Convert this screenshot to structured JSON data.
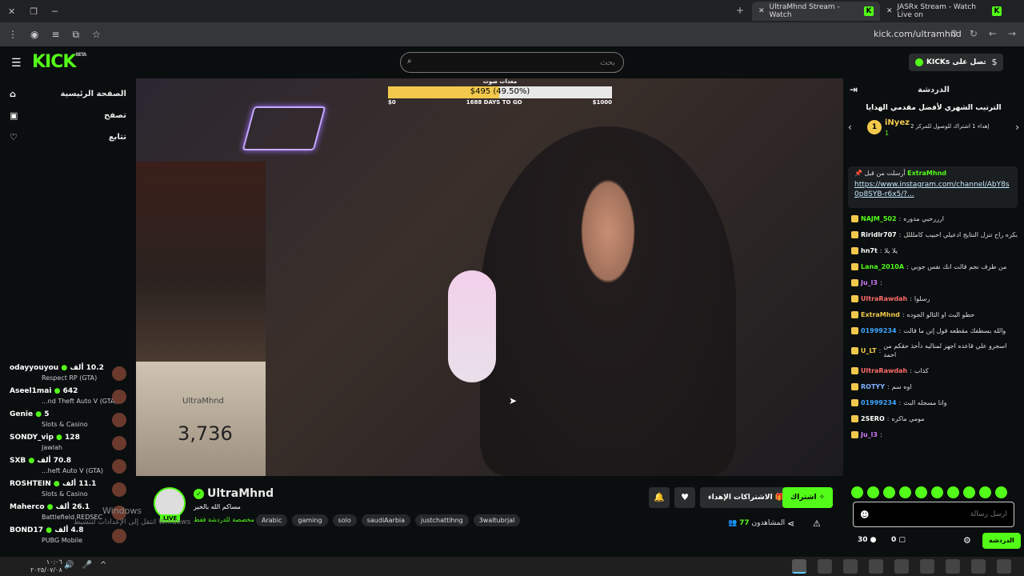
{
  "browser": {
    "tabs": [
      {
        "title": "UltraMhnd Stream - Watch",
        "active": true
      },
      {
        "title": "JASRx Stream - Watch Live on",
        "active": false
      }
    ],
    "url": "kick.com/ultramhnd"
  },
  "header": {
    "logo": "KICK",
    "logo_badge": "BETA",
    "search_placeholder": "بحث",
    "get_kicks": "احصل على KICKs",
    "accent": "#53fc18"
  },
  "sidebar": {
    "nav": [
      {
        "label": "الصفحة الرئيسية",
        "icon": "home-icon"
      },
      {
        "label": "تصفح",
        "icon": "browse-icon"
      },
      {
        "label": "تتابع",
        "icon": "heart-icon"
      }
    ],
    "recommended": [
      {
        "name": "odayyouyou",
        "game": "Respect RP (GTA)",
        "viewers": "10.2 ألف"
      },
      {
        "name": "Aseel1mai",
        "game": "...nd Theft Auto V (GTA)",
        "viewers": "642"
      },
      {
        "name": "Genie",
        "game": "Slots & Casino",
        "viewers": "5"
      },
      {
        "name": "SONDY_vip",
        "game": "Jawlah",
        "viewers": "128"
      },
      {
        "name": "SXB",
        "game": "...heft Auto V (GTA)",
        "viewers": "70.8 ألف"
      },
      {
        "name": "ROSHTEIN",
        "game": "Slots & Casino",
        "viewers": "11.1 ألف"
      },
      {
        "name": "Maherco",
        "game": "Battlefield REDSEC",
        "viewers": "26.1 ألف"
      },
      {
        "name": "BOND17",
        "game": "PUBG Mobile",
        "viewers": "4.8 ألف"
      }
    ]
  },
  "stream": {
    "goal": {
      "label": "معدات صوت",
      "amount_text": "$495 (49.50%)",
      "progress": 0.495,
      "min": "$0",
      "max": "$1000",
      "days_left": "1688 DAYS TO GO"
    },
    "overlay_name": "UltraMhnd",
    "overlay_count": "3,736",
    "streamer": "UltraMhnd",
    "title": "مساكم الله بالخير",
    "category": "مخصصة للدردشة فقط",
    "tags": [
      "Arabic",
      "gaming",
      "solo",
      "saudiAarbia",
      "justchattihng",
      "3waltubrjal"
    ],
    "live_label": "LIVE",
    "subscribe": "اشتراك",
    "gift_subs": "الاشتراكات الإهداء",
    "viewers_label": "المشاهدون",
    "viewers": "77"
  },
  "windows_watermark": {
    "line1": "Windows",
    "line2": "انتقل إلى الإعدادات لتنشيط Windows"
  },
  "chat": {
    "title": "الدردشة",
    "leaderboard_title": "الترتيب الشهري لأفضل مقدمي الهدايا",
    "leader": {
      "rank": "1",
      "name": "iNyez",
      "count": "1",
      "desc": "إهداء 1 اشتراك للوصول للمركز 2"
    },
    "pinned_by": "أرسلت من قبل",
    "pinned_user": "ExtraMhnd",
    "pinned_link": "https://www.instagram.com/channel/AbY8s0p8SYB-r6x5/?...",
    "messages": [
      {
        "user": "NAJM_502",
        "color": "#53fc18",
        "text": "ارررحبي مدوره"
      },
      {
        "user": "Riridlr707",
        "color": "#ffffff",
        "text": "بكره راح تنزل النتايج ادعيلي احبيب كاملللل"
      },
      {
        "user": "hn7t",
        "color": "#ffffff",
        "text": "يلا يلا"
      },
      {
        "user": "Lana_2010A",
        "color": "#53fc18",
        "text": "من طرف نجم قالت انك نفس جوبي"
      },
      {
        "user": "Ju_l3",
        "color": "#d17bff",
        "text": ""
      },
      {
        "user": "UltraRawdah",
        "color": "#ff6b6b",
        "text": "رسلوا"
      },
      {
        "user": "ExtraMhnd",
        "color": "#f2c94c",
        "text": "حطو البث او الثالو الجوده"
      },
      {
        "user": "01999234",
        "color": "#3fa7ff",
        "text": "والله بسطفك مقطعه قول إنن ما قالت"
      },
      {
        "user": "U_LT",
        "color": "#f2c94c",
        "text": "اسجرو علي قاعده اجهز لمناليه دأحذ حقكم من احمد"
      },
      {
        "user": "UltraRawdah",
        "color": "#ff6b6b",
        "text": "كذاب"
      },
      {
        "user": "ROTYY",
        "color": "#7fb2ff",
        "text": "اوه سم"
      },
      {
        "user": "01999234",
        "color": "#3fa7ff",
        "text": "وانا مسجله البث"
      },
      {
        "user": "2SERO",
        "color": "#ffffff",
        "text": "مومي ماكره"
      },
      {
        "user": "Ju_l3",
        "color": "#d17bff",
        "text": ""
      }
    ],
    "input_placeholder": "أرسل رسالة",
    "kicks_balance": "30",
    "points": "0",
    "send_label": "الدردشة"
  },
  "taskbar": {
    "time": "١٠:٠٦",
    "date": "٢٠٢٥/٠٧/٠٨"
  }
}
